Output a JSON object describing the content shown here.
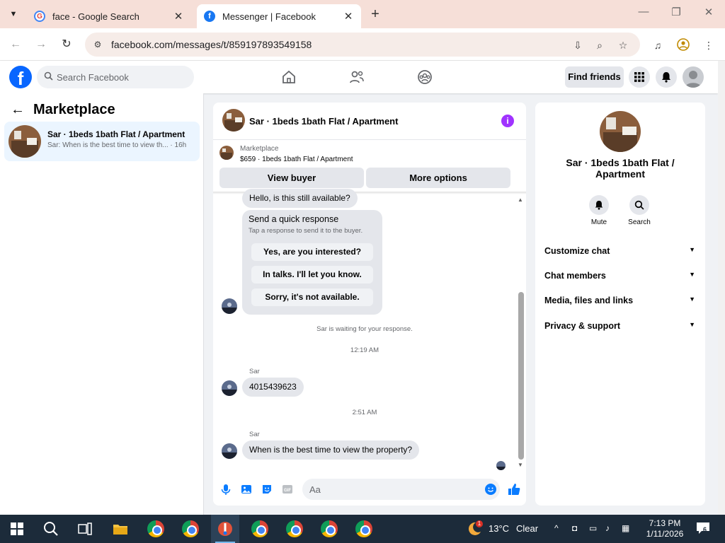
{
  "browser": {
    "tabs": [
      {
        "title": "face - Google Search",
        "favicon": "google-icon",
        "active": false
      },
      {
        "title": "Messenger | Facebook",
        "favicon": "facebook-icon",
        "active": true
      }
    ],
    "new_tab": "+",
    "url": "facebook.com/messages/t/859197893549158"
  },
  "fb_header": {
    "search_placeholder": "Search Facebook",
    "find_friends": "Find friends",
    "brand_color": "#0866ff"
  },
  "left_panel": {
    "title": "Marketplace",
    "conversations": [
      {
        "title": "Sar · 1beds 1bath Flat / Apartment",
        "preview": "Sar: When is the best time to view th... · 16h"
      }
    ]
  },
  "chat": {
    "title": "Sar · 1beds 1bath Flat / Apartment",
    "marketplace_label": "Marketplace",
    "listing": "$659 · 1beds 1bath Flat / Apartment",
    "view_buyer": "View buyer",
    "more_options": "More options",
    "first_message": "Hello, is this still available?",
    "quick_response": {
      "title": "Send a quick response",
      "subtitle": "Tap a response to send it to the buyer.",
      "options": [
        "Yes, are you interested?",
        "In talks. I'll let you know.",
        "Sorry, it's not available."
      ]
    },
    "waiting": "Sar is waiting for your response.",
    "messages": [
      {
        "time": "12:19 AM",
        "sender": "Sar",
        "text": "4015439623"
      },
      {
        "time": "2:51 AM",
        "sender": "Sar",
        "text": "When is the best time to view the property?"
      }
    ],
    "composer_placeholder": "Aa",
    "accent_color": "#0a7cff"
  },
  "right_panel": {
    "name": "Sar · 1beds 1bath Flat / Apartment",
    "actions": [
      "Mute",
      "Search"
    ],
    "sections": [
      "Customize chat",
      "Chat members",
      "Media, files and links",
      "Privacy & support"
    ]
  },
  "taskbar": {
    "weather_badge": "1",
    "temperature": "13°C",
    "weather": "Clear",
    "time": "7:13 PM",
    "date": "1/11/2026",
    "notifications": "6"
  }
}
